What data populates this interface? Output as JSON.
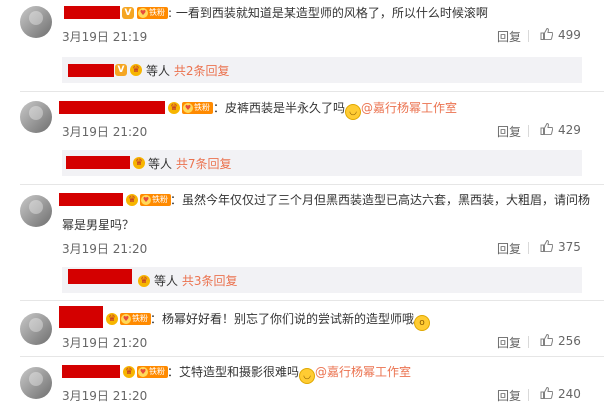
{
  "comments": [
    {
      "text_before": ": 一看到西装就知道是某造型师的风格了，所以什么时候滚啊",
      "time": "3月19日 21:19",
      "reply_label": "回复",
      "likes": "499",
      "thread": {
        "prefix": "等人",
        "count_text": "共2条回复"
      }
    },
    {
      "text_before": "：皮裤西装是半永久了吗",
      "mention": "@嘉行杨幂工作室",
      "time": "3月19日 21:20",
      "reply_label": "回复",
      "likes": "429",
      "thread": {
        "prefix": "等人",
        "count_text": "共7条回复"
      }
    },
    {
      "text_line1": "：虽然今年仅仅过了三个月但黑西装造型已高达六套，黑西装，大粗眉，请问杨",
      "text_line2": "幂是男星吗？",
      "time": "3月19日 21:20",
      "reply_label": "回复",
      "likes": "375",
      "thread": {
        "prefix": "等人",
        "count_text": "共3条回复"
      }
    },
    {
      "text_before": "：杨幂好好看！别忘了你们说的尝试新的造型师哦",
      "time": "3月19日 21:20",
      "reply_label": "回复",
      "likes": "256"
    },
    {
      "text_before": "：艾特造型和摄影很难吗",
      "mention": "@嘉行杨幂工作室",
      "time": "3月19日 21:20",
      "reply_label": "回复",
      "likes": "240"
    }
  ],
  "badge": {
    "fan_label": "铁粉",
    "vip_label": "V"
  },
  "colors": {
    "link": "#eb7350",
    "redaction": "#d40000",
    "fan_badge": "#ff8a00"
  }
}
